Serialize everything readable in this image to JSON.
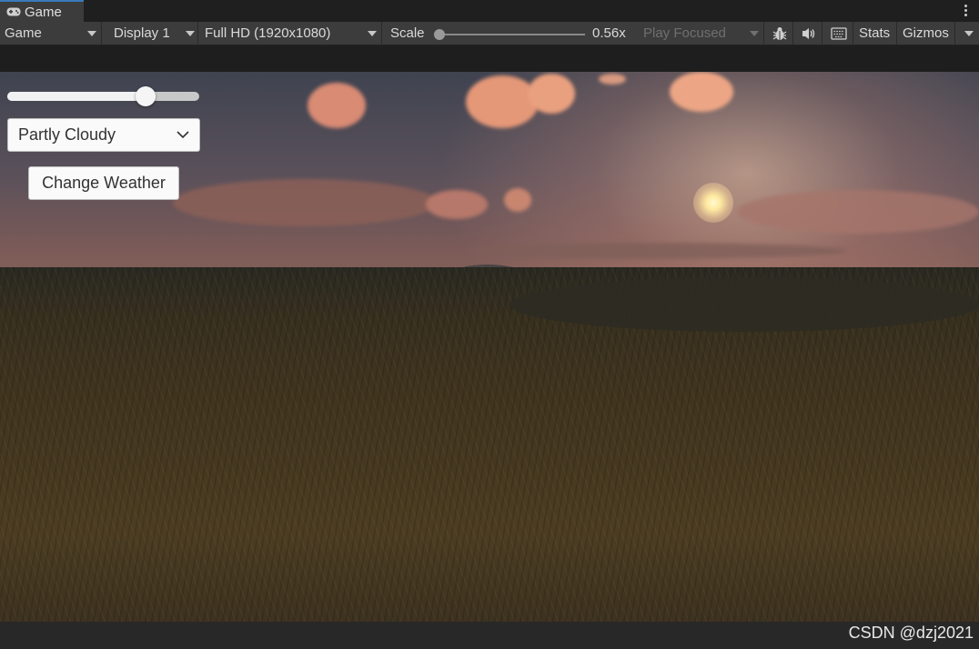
{
  "tab": {
    "title": "Game",
    "icon": "gamepad-icon"
  },
  "toolbar": {
    "view_mode": "Game",
    "display": "Display 1",
    "resolution": "Full HD (1920x1080)",
    "scale_label": "Scale",
    "scale_value": "0.56x",
    "play_mode": "Play Focused",
    "stats": "Stats",
    "gizmos": "Gizmos"
  },
  "game_ui": {
    "slider_value": 0.72,
    "weather_selected": "Partly Cloudy",
    "change_button": "Change Weather"
  },
  "watermark": "CSDN @dzj2021"
}
